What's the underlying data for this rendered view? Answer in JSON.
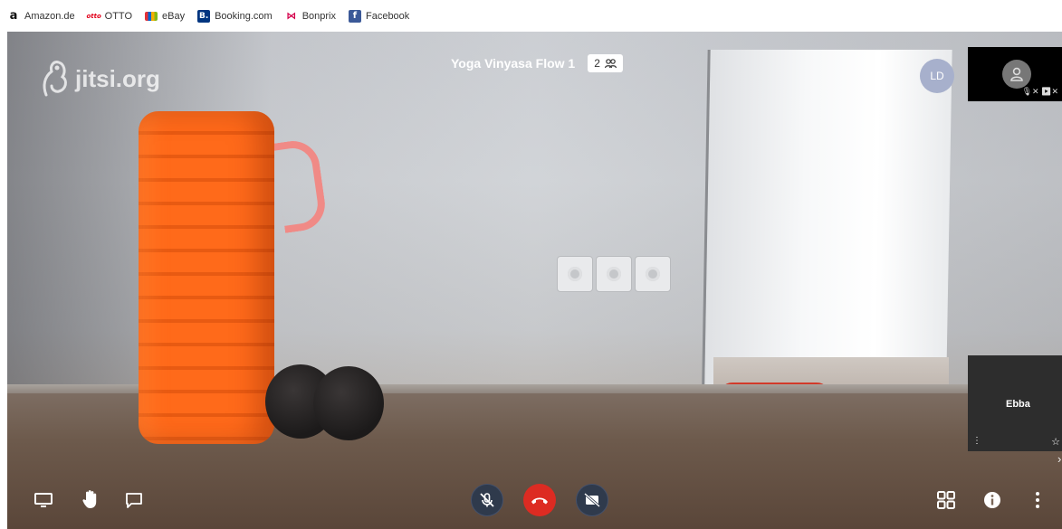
{
  "bookmarks": [
    {
      "label": "Amazon.de",
      "icon": "amazon-icon"
    },
    {
      "label": "OTTO",
      "icon": "otto-icon"
    },
    {
      "label": "eBay",
      "icon": "ebay-icon"
    },
    {
      "label": "Booking.com",
      "icon": "booking-icon"
    },
    {
      "label": "Bonprix",
      "icon": "bonprix-icon"
    },
    {
      "label": "Facebook",
      "icon": "facebook-icon"
    }
  ],
  "icon_glyphs": {
    "amazon": "a",
    "otto": "otto",
    "booking": "B.",
    "bonprix": "⋈",
    "facebook": "f"
  },
  "watermark": {
    "text": "jitsi.org"
  },
  "conference": {
    "title": "Yoga Vinyasa Flow 1",
    "participant_count": "2"
  },
  "local_avatar": {
    "initials": "LD",
    "color": "#a7b0cc"
  },
  "thumbnails": [
    {
      "name": "",
      "muted_indicators": "🎙✕ ▶✕"
    },
    {
      "name": "Ebba",
      "menu": "⋮",
      "star": "☆"
    }
  ],
  "filmstrip": {
    "toggle_glyph": "›"
  },
  "colors": {
    "hangup": "#dd2b22",
    "toolbar_button": "#2f3a4c"
  }
}
